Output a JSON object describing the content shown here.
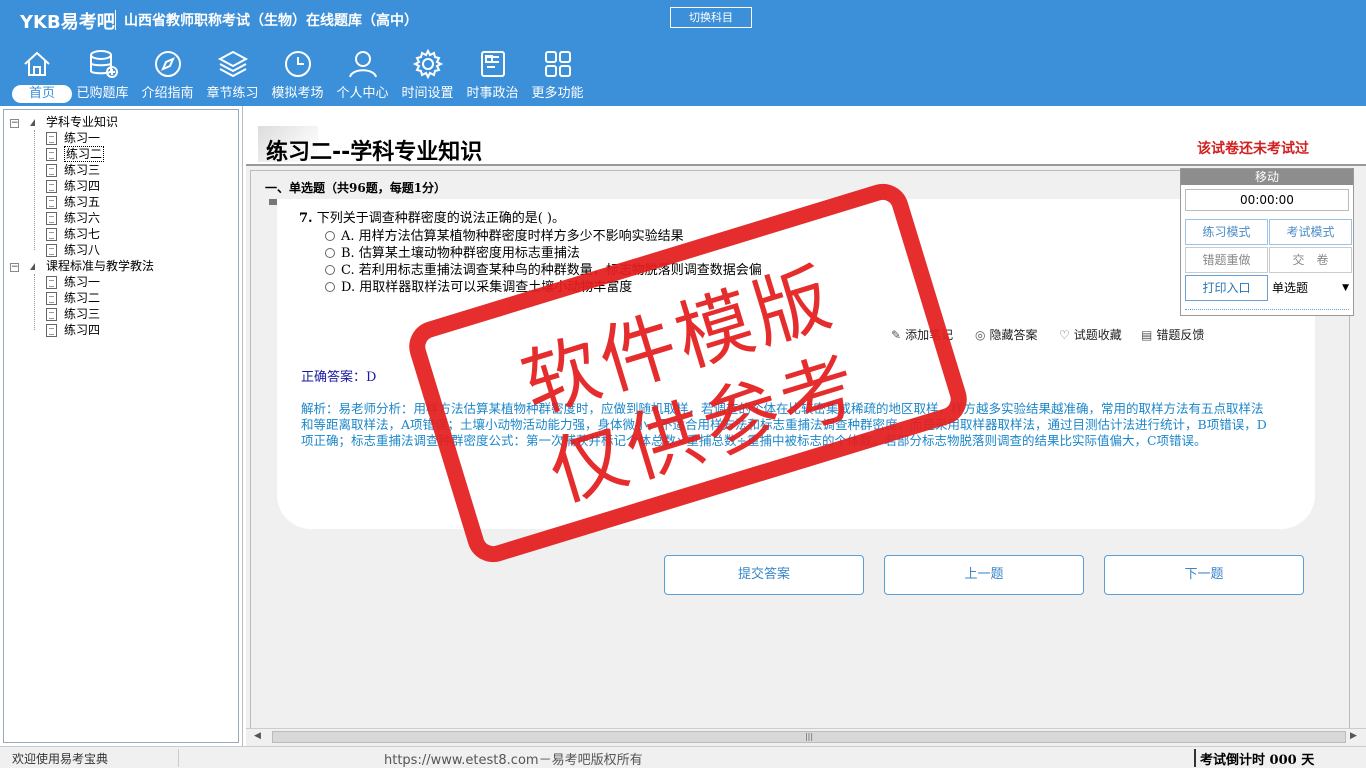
{
  "header": {
    "logo": "YKB易考吧",
    "title": "山西省教师职称考试（生物）在线题库（高中）",
    "switch_subject": "切换科目"
  },
  "nav": [
    {
      "label": "首页",
      "icon": "home-icon"
    },
    {
      "label": "已购题库",
      "icon": "database-icon"
    },
    {
      "label": "介绍指南",
      "icon": "compass-icon"
    },
    {
      "label": "章节练习",
      "icon": "layers-icon"
    },
    {
      "label": "模拟考场",
      "icon": "clock-icon"
    },
    {
      "label": "个人中心",
      "icon": "user-icon"
    },
    {
      "label": "时间设置",
      "icon": "gear-icon"
    },
    {
      "label": "时事政治",
      "icon": "news-icon"
    },
    {
      "label": "更多功能",
      "icon": "grid-icon"
    }
  ],
  "tree": {
    "groups": [
      {
        "label": "学科专业知识",
        "items": [
          "练习一",
          "练习二",
          "练习三",
          "练习四",
          "练习五",
          "练习六",
          "练习七",
          "练习八"
        ]
      },
      {
        "label": "课程标准与教学教法",
        "items": [
          "练习一",
          "练习二",
          "练习三",
          "练习四"
        ]
      }
    ],
    "selected": "练习二"
  },
  "paper": {
    "title": "练习二--学科专业知识",
    "status": "该试卷还未考试过",
    "section": "一、单选题（共96题，每题1分）"
  },
  "question": {
    "number": "7.",
    "text": "下列关于调查种群密度的说法正确的是( )。",
    "options": [
      "A. 用样方法估算某植物种群密度时样方多少不影响实验结果",
      "B. 估算某土壤动物种群密度用标志重捕法",
      "C. 若利用标志重捕法调查某种鸟的种群数量，标志物脱落则调查数据会偏",
      "D. 用取样器取样法可以采集调查土壤小动物丰富度"
    ],
    "tools": [
      "添加笔记",
      "隐藏答案",
      "试题收藏",
      "错题反馈"
    ],
    "answer": "正确答案：D",
    "analysis": "解析：易老师分析：用样方法估算某植物种群密度时，应做到随机取样，若调查的个体在比较密集或稀疏的地区取样，样方越多实验结果越准确，常用的取样方法有五点取样法和等距离取样法，A项错误；土壤小动物活动能力强，身体微小，不适合用样方法和标志重捕法调查种群密度，而是采用取样器取样法，通过目测估计法进行统计，B项错误，D项正确；标志重捕法调查种群密度公式：第一次捕获并标记个体总数×重捕总数÷重捕中被标志的个体数，若部分标志物脱落则调查的结果比实际值偏大，C项错误。"
  },
  "buttons": {
    "submit": "提交答案",
    "prev": "上一题",
    "next": "下一题"
  },
  "panel": {
    "move": "移动",
    "timer": "00:00:00",
    "practice_mode": "练习模式",
    "exam_mode": "考试模式",
    "redo_wrong": "错题重做",
    "hand_in": "交　卷",
    "print": "打印入口",
    "qtype": "单选题"
  },
  "status": {
    "welcome": "欢迎使用易考宝典",
    "url": "https://www.etest8.com－易考吧版权所有",
    "countdown": "考试倒计时 000 天"
  },
  "watermark": {
    "line1": "软件模版",
    "line2": "仅供参考"
  },
  "colors": {
    "header_bg": "#3c8fd9",
    "status_red": "#d21f1f",
    "analysis_blue": "#1c87c9",
    "stamp_red": "#e41e1e"
  }
}
